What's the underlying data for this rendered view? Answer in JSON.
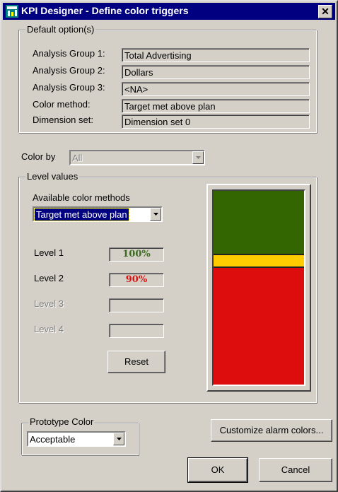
{
  "window": {
    "title": "KPI Designer - Define color triggers",
    "close_glyph": "✕",
    "app_icon": "kpi-designer-icon"
  },
  "default_options": {
    "legend": "Default option(s)",
    "rows": [
      {
        "label": "Analysis Group 1:",
        "value": "Total Advertising"
      },
      {
        "label": "Analysis Group 2:",
        "value": "Dollars"
      },
      {
        "label": "Analysis Group 3:",
        "value": "<NA>"
      },
      {
        "label": "Color method:",
        "value": "Target met above plan"
      },
      {
        "label": "Dimension set:",
        "value": "Dimension set 0"
      }
    ]
  },
  "color_by": {
    "label": "Color by",
    "value": "All"
  },
  "level_values": {
    "legend": "Level values",
    "methods_label": "Available color methods",
    "selected_method": "Target met above plan",
    "levels": [
      {
        "label": "Level 1",
        "value": "100%",
        "color": "#3a6b1f",
        "enabled": true
      },
      {
        "label": "Level 2",
        "value": "90%",
        "color": "#dd1111",
        "enabled": true
      },
      {
        "label": "Level 3",
        "value": "",
        "enabled": false
      },
      {
        "label": "Level 4",
        "value": "",
        "enabled": false
      }
    ],
    "reset_label": "Reset",
    "bands": [
      {
        "name": "green",
        "color": "#336600",
        "share": 0.323
      },
      {
        "name": "yellow",
        "color": "#ffcc00",
        "share": 0.065
      },
      {
        "name": "red",
        "color": "#dd0d0d",
        "share": 0.612
      }
    ]
  },
  "prototype_color": {
    "legend": "Prototype Color",
    "value": "Acceptable"
  },
  "buttons": {
    "customize": "Customize alarm colors...",
    "ok": "OK",
    "cancel": "Cancel"
  }
}
